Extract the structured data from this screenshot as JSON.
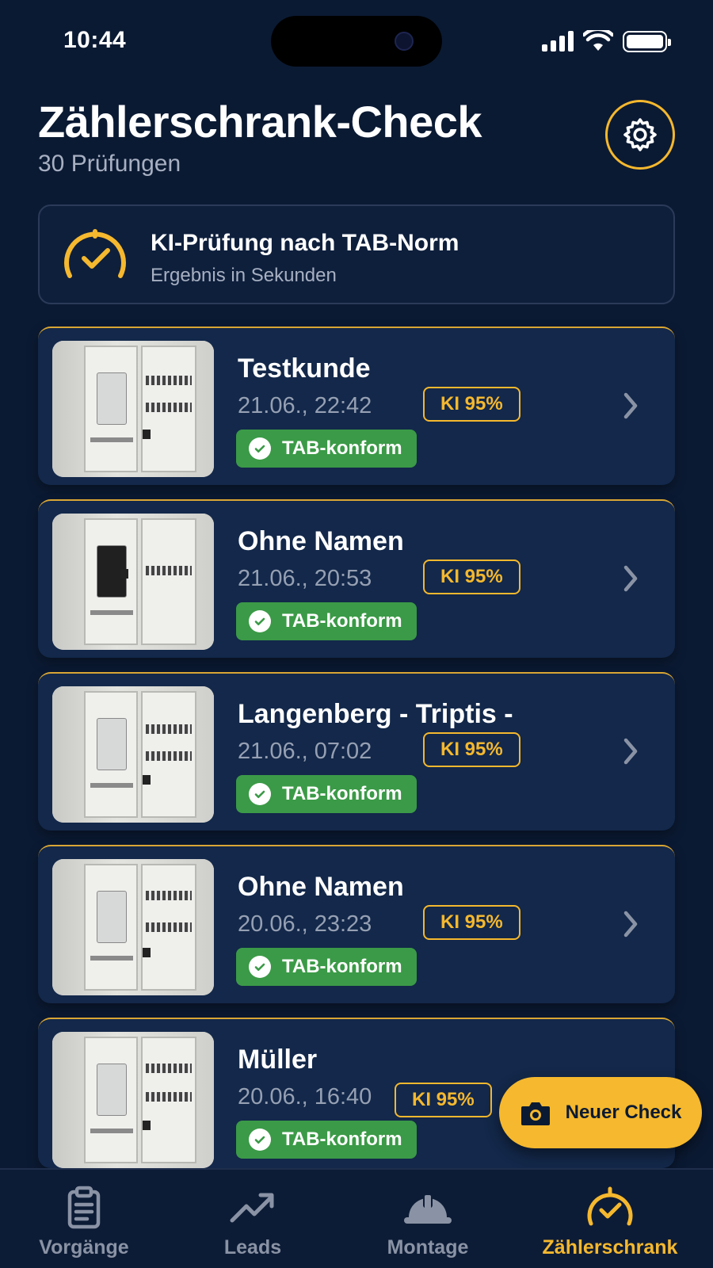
{
  "status_bar": {
    "time": "10:44"
  },
  "header": {
    "title": "Zählerschrank-Check",
    "subtitle": "30 Prüfungen",
    "settings_icon": "gear-icon"
  },
  "info_card": {
    "title": "KI-Prüfung nach TAB-Norm",
    "subtitle": "Ergebnis in Sekunden",
    "icon": "gauge-check-icon"
  },
  "checks": [
    {
      "name": "Testkunde",
      "date": "21.06., 22:42",
      "ki": "KI 95%",
      "status": "TAB-konform"
    },
    {
      "name": "Ohne Namen",
      "date": "21.06., 20:53",
      "ki": "KI 95%",
      "status": "TAB-konform"
    },
    {
      "name": "Langenberg - Triptis -",
      "date": "21.06., 07:02",
      "ki": "KI 95%",
      "status": "TAB-konform"
    },
    {
      "name": "Ohne Namen",
      "date": "20.06., 23:23",
      "ki": "KI 95%",
      "status": "TAB-konform"
    },
    {
      "name": "Müller",
      "date": "20.06., 16:40",
      "ki": "KI 95%",
      "status": "TAB-konform"
    }
  ],
  "fab": {
    "label": "Neuer Check",
    "icon": "camera-icon"
  },
  "tabs": [
    {
      "label": "Vorgänge",
      "icon": "clipboard-icon"
    },
    {
      "label": "Leads",
      "icon": "trend-up-icon"
    },
    {
      "label": "Montage",
      "icon": "hard-hat-icon"
    },
    {
      "label": "Zählerschrank",
      "icon": "gauge-check-icon",
      "active": true
    }
  ],
  "colors": {
    "background": "#0b1a33",
    "accent": "#f5b82e",
    "success": "#3b9a47"
  }
}
